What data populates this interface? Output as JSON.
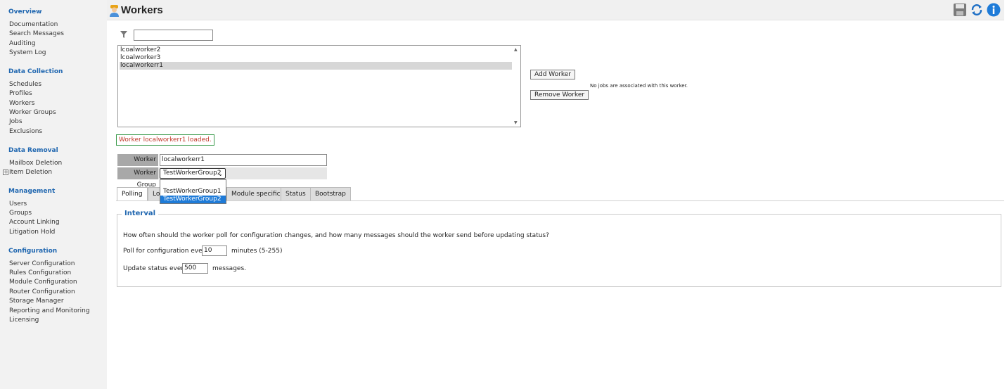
{
  "sidebar": {
    "sections": [
      {
        "title": "Overview",
        "items": [
          "Documentation",
          "Search Messages",
          "Auditing",
          "System Log"
        ]
      },
      {
        "title": "Data Collection",
        "items": [
          "Schedules",
          "Profiles",
          "Workers",
          "Worker Groups",
          "Jobs",
          "Exclusions"
        ]
      },
      {
        "title": "Data Removal",
        "items": [
          "Mailbox Deletion",
          "Item Deletion"
        ]
      },
      {
        "title": "Management",
        "items": [
          "Users",
          "Groups",
          "Account Linking",
          "Litigation Hold"
        ]
      },
      {
        "title": "Configuration",
        "items": [
          "Server Configuration",
          "Rules Configuration",
          "Module Configuration",
          "Router Configuration",
          "Storage Manager",
          "Reporting and Monitoring",
          "Licensing"
        ]
      }
    ],
    "expand_glyph": "+"
  },
  "header": {
    "title": "Workers",
    "icons": [
      "worker-icon",
      "save-icon",
      "refresh-icon",
      "info-icon"
    ],
    "accent": "#1e7bd8"
  },
  "filter": {
    "value": ""
  },
  "worker_list": {
    "rows": [
      "lcoalworker2",
      "lcoalworker3",
      "localworkerr1"
    ],
    "selected": "localworkerr1",
    "scroll_up": "▲",
    "scroll_down": "▼"
  },
  "buttons": {
    "add_worker": "Add Worker",
    "remove_worker": "Remove Worker"
  },
  "no_jobs_text": "No jobs are associated with this worker.",
  "status_message": "Worker localworkerr1 loaded.",
  "form": {
    "worker_label": "Worker",
    "worker_value": "localworkerr1",
    "group_label": "Worker Group",
    "group_value": "TestWorkerGroup2",
    "group_chevron": "⌄",
    "group_options": [
      "TestWorkerGroup1",
      "TestWorkerGroup2"
    ]
  },
  "tabs": [
    "Polling",
    "Lo",
    "Module specific",
    "Status",
    "Bootstrap"
  ],
  "interval": {
    "legend": "Interval",
    "question": "How often should the worker poll for configuration changes, and how many messages should the worker send before updating status?",
    "poll_prefix": "Poll for configuration every",
    "poll_value": "10",
    "poll_suffix": "minutes (5-255)",
    "status_prefix": "Update status every",
    "status_value": "500",
    "status_suffix": "messages."
  },
  "colors": {
    "nav_title": "#2067b0",
    "status_text": "#c0392b",
    "status_border": "#3a9a4a",
    "selection": "#1e7bd8"
  }
}
